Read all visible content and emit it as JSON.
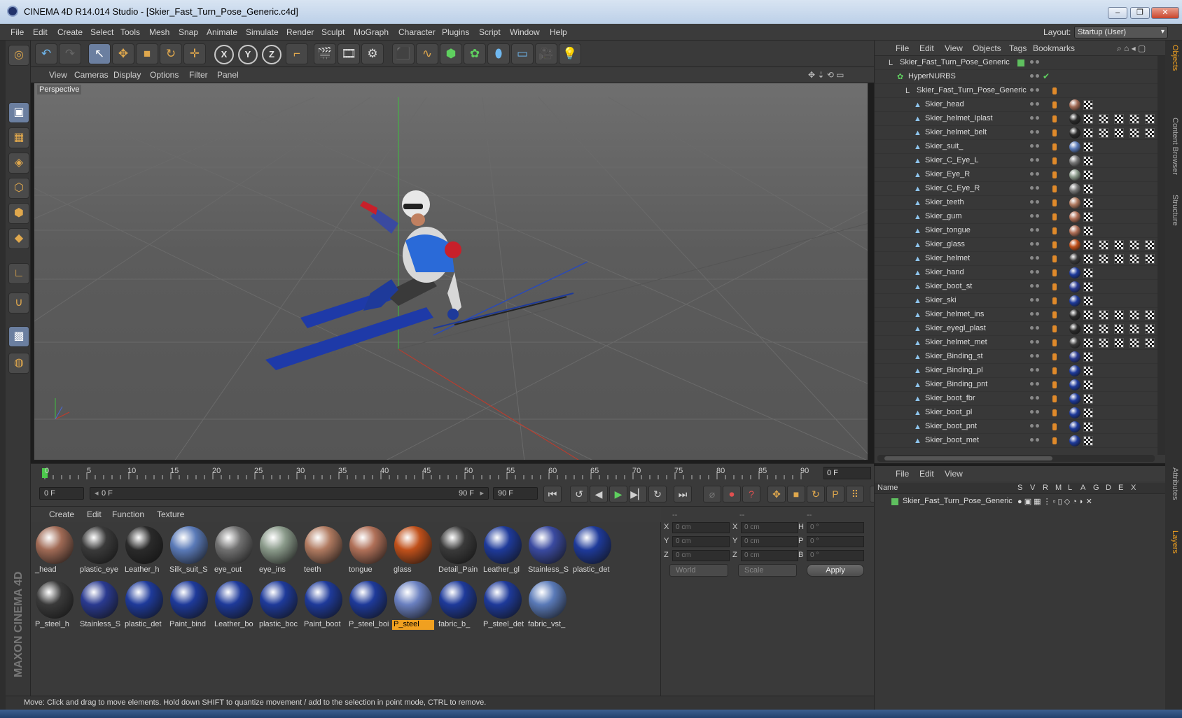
{
  "window": {
    "title": "CINEMA 4D R14.014 Studio - [Skier_Fast_Turn_Pose_Generic.c4d]"
  },
  "menu": [
    "File",
    "Edit",
    "Create",
    "Select",
    "Tools",
    "Mesh",
    "Snap",
    "Animate",
    "Simulate",
    "Render",
    "Sculpt",
    "MoGraph",
    "Character",
    "Plugins",
    "Script",
    "Window",
    "Help"
  ],
  "layout": {
    "label": "Layout:",
    "value": "Startup (User)"
  },
  "viewport": {
    "menu": [
      "View",
      "Cameras",
      "Display",
      "Options",
      "Filter",
      "Panel"
    ],
    "label": "Perspective"
  },
  "timeline": {
    "ticks": [
      "0",
      "5",
      "10",
      "15",
      "20",
      "25",
      "30",
      "35",
      "40",
      "45",
      "50",
      "55",
      "60",
      "65",
      "70",
      "75",
      "80",
      "85",
      "90"
    ],
    "current_frame": "0 F"
  },
  "transport": {
    "start": "0 F",
    "range_start": "0 F",
    "range_end": "90 F",
    "end": "90 F"
  },
  "materials_menu": [
    "Create",
    "Edit",
    "Function",
    "Texture"
  ],
  "materials": [
    {
      "name": "_head",
      "color": "#a06a55"
    },
    {
      "name": "plastic_eye",
      "color": "#3a3a3a"
    },
    {
      "name": "Leather_h",
      "color": "#2a2a2a"
    },
    {
      "name": "Silk_suit_S",
      "color": "#5a7ab8"
    },
    {
      "name": "eye_out",
      "color": "#707070"
    },
    {
      "name": "eye_ins",
      "color": "#8a9a8a"
    },
    {
      "name": "teeth",
      "color": "#b07a60"
    },
    {
      "name": "tongue",
      "color": "#b07058"
    },
    {
      "name": "glass",
      "color": "#c0501a"
    },
    {
      "name": "Detail_Pain",
      "color": "#3a3a3a"
    },
    {
      "name": "Leather_gl",
      "color": "#1e3a9a"
    },
    {
      "name": "Stainless_S",
      "color": "#3a4aa0"
    },
    {
      "name": "plastic_det",
      "color": "#1e3a9a"
    },
    {
      "name": "P_steel_h",
      "color": "#3a3a3a"
    },
    {
      "name": "Stainless_S",
      "color": "#2a3a90"
    },
    {
      "name": "plastic_det",
      "color": "#1e3a9a"
    },
    {
      "name": "Paint_bind",
      "color": "#1e3a9a"
    },
    {
      "name": "Leather_bo",
      "color": "#1e3a9a"
    },
    {
      "name": "plastic_boc",
      "color": "#1e3a9a"
    },
    {
      "name": "Paint_boot",
      "color": "#1e3a9a"
    },
    {
      "name": "P_steel_boi",
      "color": "#1e3a9a"
    },
    {
      "name": "P_steel",
      "color": "#6a80c0"
    },
    {
      "name": "fabric_b_",
      "color": "#1e3a9a"
    },
    {
      "name": "P_steel_det",
      "color": "#1e3a9a"
    },
    {
      "name": "fabric_vst_",
      "color": "#5a7ab8"
    }
  ],
  "selected_material_index": 21,
  "coords": {
    "header": [
      "--",
      "--",
      "--"
    ],
    "rows": [
      {
        "a": "X",
        "av": "0 cm",
        "b": "X",
        "bv": "0 cm",
        "c": "H",
        "cv": "0 °"
      },
      {
        "a": "Y",
        "av": "0 cm",
        "b": "Y",
        "bv": "0 cm",
        "c": "P",
        "cv": "0 °"
      },
      {
        "a": "Z",
        "av": "0 cm",
        "b": "Z",
        "bv": "0 cm",
        "c": "B",
        "cv": "0 °"
      }
    ],
    "mode1": "World",
    "mode2": "Scale",
    "apply": "Apply"
  },
  "status": "Move: Click and drag to move elements. Hold down SHIFT to quantize movement / add to the selection in point mode, CTRL to remove.",
  "object_menu": [
    "File",
    "Edit",
    "View",
    "Objects",
    "Tags",
    "Bookmarks"
  ],
  "objects": [
    {
      "name": "Skier_Fast_Turn_Pose_Generic",
      "level": 0,
      "type": "null",
      "mat": "",
      "checks": 0
    },
    {
      "name": "HyperNURBS",
      "level": 1,
      "type": "nurbs",
      "mat": "",
      "checks": 0
    },
    {
      "name": "Skier_Fast_Turn_Pose_Generic",
      "level": 2,
      "type": "null",
      "mat": "",
      "checks": 0
    },
    {
      "name": "Skier_head",
      "level": 3,
      "type": "mesh",
      "mat": "#a06a55",
      "checks": 1
    },
    {
      "name": "Skier_helmet_Iplast",
      "level": 3,
      "type": "mesh",
      "mat": "#2a2a2a",
      "checks": 5
    },
    {
      "name": "Skier_helmet_belt",
      "level": 3,
      "type": "mesh",
      "mat": "#2a2a2a",
      "checks": 5
    },
    {
      "name": "Skier_suit_",
      "level": 3,
      "type": "mesh",
      "mat": "#5a7ab8",
      "checks": 1
    },
    {
      "name": "Skier_C_Eye_L",
      "level": 3,
      "type": "mesh",
      "mat": "#777777",
      "checks": 1
    },
    {
      "name": "Skier_Eye_R",
      "level": 3,
      "type": "mesh",
      "mat": "#8a9a8a",
      "checks": 1
    },
    {
      "name": "Skier_C_Eye_R",
      "level": 3,
      "type": "mesh",
      "mat": "#777777",
      "checks": 1
    },
    {
      "name": "Skier_teeth",
      "level": 3,
      "type": "mesh",
      "mat": "#b07a60",
      "checks": 1
    },
    {
      "name": "Skier_gum",
      "level": 3,
      "type": "mesh",
      "mat": "#b07058",
      "checks": 1
    },
    {
      "name": "Skier_tongue",
      "level": 3,
      "type": "mesh",
      "mat": "#b07058",
      "checks": 1
    },
    {
      "name": "Skier_glass",
      "level": 3,
      "type": "mesh",
      "mat": "#c0501a",
      "checks": 5
    },
    {
      "name": "Skier_helmet",
      "level": 3,
      "type": "mesh",
      "mat": "#3a3a3a",
      "checks": 5
    },
    {
      "name": "Skier_hand",
      "level": 3,
      "type": "mesh",
      "mat": "#1e3a9a",
      "checks": 1
    },
    {
      "name": "Skier_boot_st",
      "level": 3,
      "type": "mesh",
      "mat": "#2a3a90",
      "checks": 1
    },
    {
      "name": "Skier_ski",
      "level": 3,
      "type": "mesh",
      "mat": "#1e3a9a",
      "checks": 1
    },
    {
      "name": "Skier_helmet_ins",
      "level": 3,
      "type": "mesh",
      "mat": "#2a2a2a",
      "checks": 5
    },
    {
      "name": "Skier_eyegl_plast",
      "level": 3,
      "type": "mesh",
      "mat": "#2a2a2a",
      "checks": 5
    },
    {
      "name": "Skier_helmet_met",
      "level": 3,
      "type": "mesh",
      "mat": "#3a3a3a",
      "checks": 5
    },
    {
      "name": "Skier_Binding_st",
      "level": 3,
      "type": "mesh",
      "mat": "#2a3a90",
      "checks": 1
    },
    {
      "name": "Skier_Binding_pl",
      "level": 3,
      "type": "mesh",
      "mat": "#1e3a9a",
      "checks": 1
    },
    {
      "name": "Skier_Binding_pnt",
      "level": 3,
      "type": "mesh",
      "mat": "#1e3a9a",
      "checks": 1
    },
    {
      "name": "Skier_boot_fbr",
      "level": 3,
      "type": "mesh",
      "mat": "#1e3a9a",
      "checks": 1
    },
    {
      "name": "Skier_boot_pl",
      "level": 3,
      "type": "mesh",
      "mat": "#1e3a9a",
      "checks": 1
    },
    {
      "name": "Skier_boot_pnt",
      "level": 3,
      "type": "mesh",
      "mat": "#1e3a9a",
      "checks": 1
    },
    {
      "name": "Skier_boot_met",
      "level": 3,
      "type": "mesh",
      "mat": "#1e3a9a",
      "checks": 1
    }
  ],
  "layer_menu": [
    "File",
    "Edit",
    "View"
  ],
  "layer_columns": [
    "Name",
    "S",
    "V",
    "R",
    "M",
    "L",
    "A",
    "G",
    "D",
    "E",
    "X"
  ],
  "layer_row": "Skier_Fast_Turn_Pose_Generic",
  "right_tabs": [
    "Objects",
    "Content Browser",
    "Structure",
    "Attributes",
    "Layers"
  ],
  "brand": "MAXON CINEMA 4D",
  "colors": {
    "accent": "#f0a020",
    "selection": "#6b7fa0"
  }
}
